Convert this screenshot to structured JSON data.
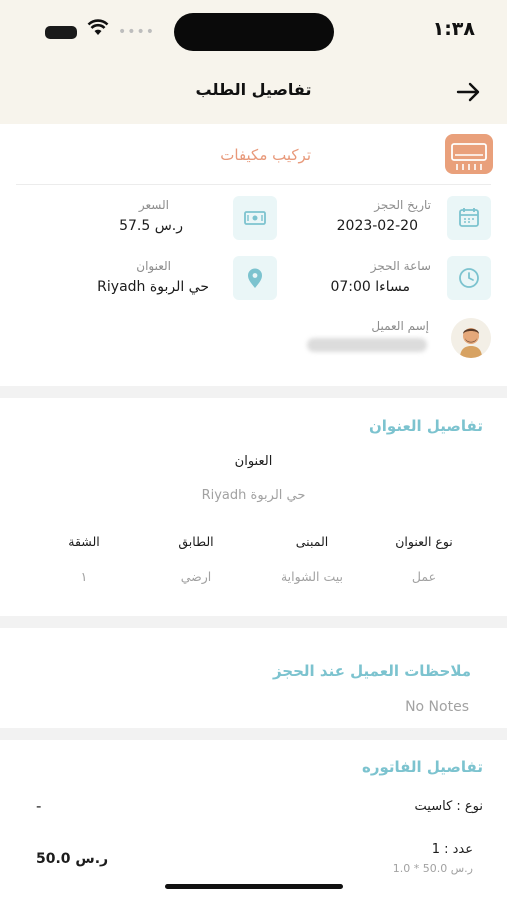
{
  "status_bar": {
    "time": "١:٣٨"
  },
  "header": {
    "title": "تفاصيل الطلب"
  },
  "service": {
    "name": "تركيب مكيفات"
  },
  "booking": {
    "date_label": "تاريخ الحجز",
    "date_value": "2023-02-20",
    "price_label": "السعر",
    "price_value": "57.5 ر.س",
    "time_label": "ساعة الحجز",
    "time_value": "07:00 مساءا",
    "address_label": "العنوان",
    "address_value": "Riyadh حي الربوة",
    "customer_label": "إسم العميل"
  },
  "address_details": {
    "title": "تفاصيل العنوان",
    "address_label": "العنوان",
    "address_value": "Riyadh حي الربوة",
    "columns": [
      {
        "label": "نوع العنوان",
        "value": "عمل"
      },
      {
        "label": "المبنى",
        "value": "بيت الشواية"
      },
      {
        "label": "الطابق",
        "value": "ارضي"
      },
      {
        "label": "الشقة",
        "value": "١"
      }
    ]
  },
  "notes": {
    "title": "ملاحظات العميل عند الحجز",
    "value": "No Notes"
  },
  "invoice": {
    "title": "تفاصيل الفاتوره",
    "type_label": "نوع : كاسيت",
    "type_value": "-",
    "count_label": "عدد : 1",
    "calc": "1.0 * 50.0 ر.س",
    "total": "50.0 ر.س"
  },
  "colors": {
    "accent": "#7cc3cf",
    "service_orange": "#e8997a",
    "background": "#f7f4ec"
  }
}
